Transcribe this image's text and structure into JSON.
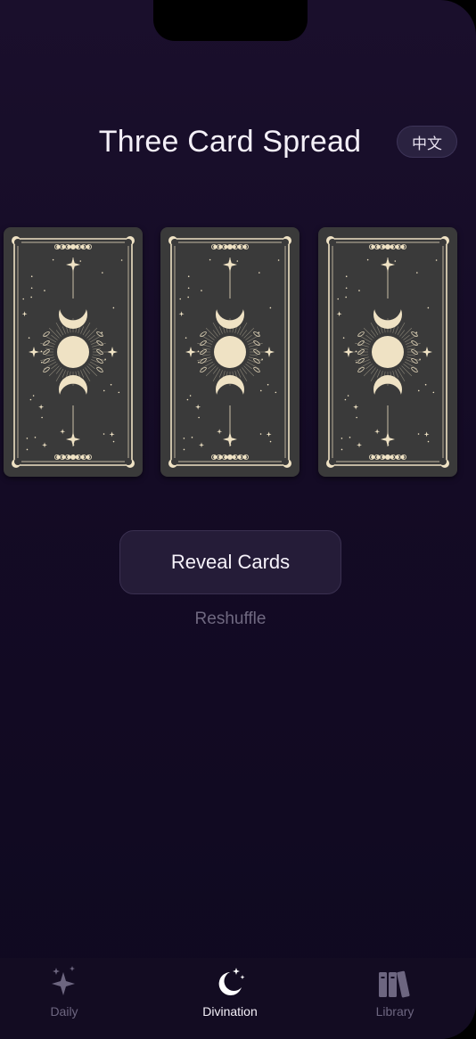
{
  "header": {
    "title": "Three Card Spread",
    "language_toggle": "中文"
  },
  "cards": [
    {
      "name": "card-back-1",
      "state": "face-down"
    },
    {
      "name": "card-back-2",
      "state": "face-down"
    },
    {
      "name": "card-back-3",
      "state": "face-down"
    }
  ],
  "actions": {
    "reveal_label": "Reveal Cards",
    "reshuffle_label": "Reshuffle"
  },
  "tabbar": {
    "tabs": [
      {
        "label": "Daily",
        "icon": "sparkles-icon",
        "active": false
      },
      {
        "label": "Divination",
        "icon": "moon-stars-icon",
        "active": true
      },
      {
        "label": "Library",
        "icon": "books-icon",
        "active": false
      }
    ]
  },
  "colors": {
    "background": "#1a0f2c",
    "card_back": "#3a3a3a",
    "card_ornament": "#efe2c4",
    "text_primary": "#f4f0f8",
    "text_muted": "#6f6880"
  }
}
